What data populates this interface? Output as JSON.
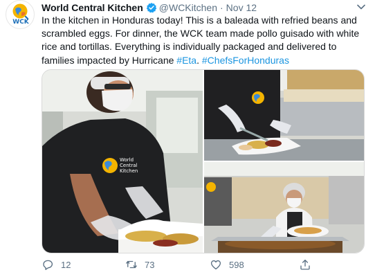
{
  "tweet": {
    "avatar": {
      "text": "WCK",
      "icon": "wck-logo-icon"
    },
    "author_name": "World Central Kitchen",
    "handle": "@WCKitchen",
    "separator": "·",
    "date": "Nov 12",
    "text": {
      "line1": "In the kitchen in Honduras today! This is a baleada with refried beans and",
      "line2": "scrambled eggs. For dinner, the WCK team made pollo guisado with white",
      "line3": "rice and tortillas. Everything is individually packaged and delivered to",
      "line4_pre": "families impacted by Hurricane ",
      "hashtag1": "#Eta",
      "line4_mid": ". ",
      "hashtag2": "#ChefsForHonduras"
    },
    "media": {
      "apron_text_1": "World",
      "apron_text_2": "Central",
      "apron_text_3": "Kitchen"
    },
    "actions": {
      "replies": "12",
      "retweets": "73",
      "likes": "598"
    }
  },
  "colors": {
    "text": "#0f1419",
    "secondary": "#5b7083",
    "link": "#1b95e0",
    "verified": "#1da1f2"
  }
}
